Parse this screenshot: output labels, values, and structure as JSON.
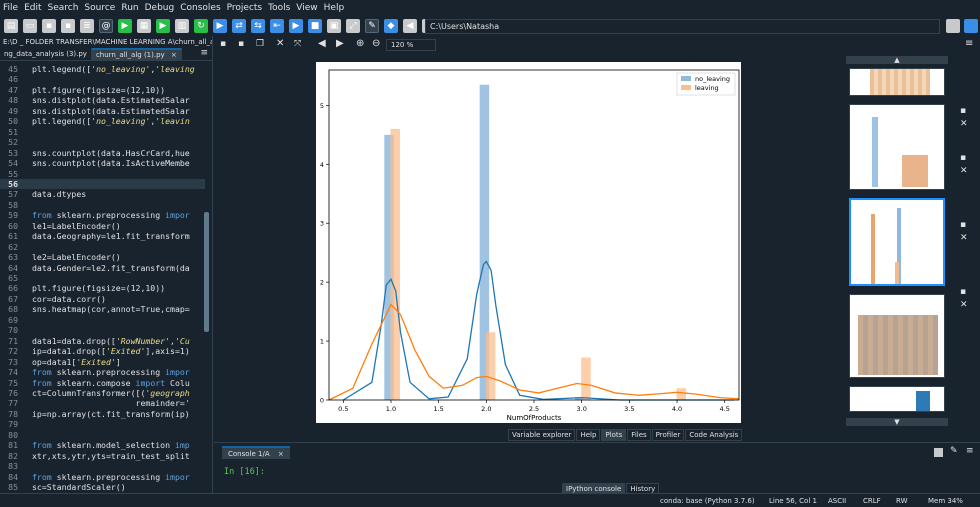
{
  "menu": [
    "File",
    "Edit",
    "Search",
    "Source",
    "Run",
    "Debug",
    "Consoles",
    "Projects",
    "Tools",
    "View",
    "Help"
  ],
  "toolbar": {
    "path": "C:\\Users\\Natasha"
  },
  "editor": {
    "file_path": "E:\\D _ FOLDER TRANSFER\\MACHINE LEARNING A\\churn_all_alg (1).py",
    "tabs": [
      {
        "label": "ng_data_analysis (3).py",
        "active": false
      },
      {
        "label": "churn_all_alg (1).py",
        "active": true
      }
    ],
    "tab_close": "×",
    "lines": [
      {
        "n": "45",
        "t": "plt.legend(['no_leaving','leaving"
      },
      {
        "n": "46",
        "t": ""
      },
      {
        "n": "47",
        "t": "plt.figure(figsize=(12,10))"
      },
      {
        "n": "48",
        "t": "sns.distplot(data.EstimatedSalar"
      },
      {
        "n": "49",
        "t": "sns.distplot(data.EstimatedSalar"
      },
      {
        "n": "50",
        "t": "plt.legend(['no_leaving','leavin"
      },
      {
        "n": "51",
        "t": ""
      },
      {
        "n": "52",
        "t": ""
      },
      {
        "n": "53",
        "t": "sns.countplot(data.HasCrCard,hue"
      },
      {
        "n": "54",
        "t": "sns.countplot(data.IsActiveMembe"
      },
      {
        "n": "55",
        "t": ""
      },
      {
        "n": "56",
        "t": ""
      },
      {
        "n": "57",
        "t": "data.dtypes"
      },
      {
        "n": "58",
        "t": ""
      },
      {
        "n": "59",
        "t": "from sklearn.preprocessing impor"
      },
      {
        "n": "60",
        "t": "le1=LabelEncoder()"
      },
      {
        "n": "61",
        "t": "data.Geography=le1.fit_transform"
      },
      {
        "n": "62",
        "t": ""
      },
      {
        "n": "63",
        "t": "le2=LabelEncoder()"
      },
      {
        "n": "64",
        "t": "data.Gender=le2.fit_transform(da"
      },
      {
        "n": "65",
        "t": ""
      },
      {
        "n": "66",
        "t": "plt.figure(figsize=(12,10))"
      },
      {
        "n": "67",
        "t": "cor=data.corr()"
      },
      {
        "n": "68",
        "t": "sns.heatmap(cor,annot=True,cmap="
      },
      {
        "n": "69",
        "t": ""
      },
      {
        "n": "70",
        "t": ""
      },
      {
        "n": "71",
        "t": "data1=data.drop(['RowNumber','Cu"
      },
      {
        "n": "72",
        "t": "ip=data1.drop(['Exited'],axis=1)"
      },
      {
        "n": "73",
        "t": "op=data1['Exited']"
      },
      {
        "n": "74",
        "t": "from sklearn.preprocessing impor"
      },
      {
        "n": "75",
        "t": "from sklearn.compose import Colu"
      },
      {
        "n": "76",
        "t": "ct=ColumnTransformer([('geograph"
      },
      {
        "n": "77",
        "t": "                     remainder='"
      },
      {
        "n": "78",
        "t": "ip=np.array(ct.fit_transform(ip)"
      },
      {
        "n": "79",
        "t": ""
      },
      {
        "n": "80",
        "t": ""
      },
      {
        "n": "81",
        "t": "from sklearn.model_selection imp"
      },
      {
        "n": "82",
        "t": "xtr,xts,ytr,yts=train_test_split"
      },
      {
        "n": "83",
        "t": ""
      },
      {
        "n": "84",
        "t": "from sklearn.preprocessing impor"
      },
      {
        "n": "85",
        "t": "sc=StandardScaler()"
      }
    ]
  },
  "plots": {
    "zoom": "120 %",
    "pane_tabs": [
      "Variable explorer",
      "Help",
      "Plots",
      "Files",
      "Profiler",
      "Code Analysis"
    ],
    "active_pane_tab": "Plots"
  },
  "console": {
    "tab_label": "Console 1/A",
    "tab_close": "×",
    "prompt": "In [16]:",
    "pane_tabs": [
      "IPython console",
      "History"
    ],
    "active_pane_tab": "IPython console"
  },
  "status": {
    "conda": "conda: base (Python 3.7.6)",
    "position": "Line 56, Col 1",
    "encoding": "ASCII",
    "eol": "CRLF",
    "rw": "RW",
    "mem": "Mem 34%"
  },
  "colors": {
    "no_leaving": "#1f77b4",
    "leaving": "#ff7f0e",
    "accent": "#1464a0"
  },
  "chart_data": {
    "type": "bar",
    "xlabel": "NumOfProducts",
    "ylabel": "",
    "xlim": [
      0.35,
      4.65
    ],
    "ylim": [
      0,
      5.6
    ],
    "xticks": [
      "0.5",
      "1.0",
      "1.5",
      "2.0",
      "2.5",
      "3.0",
      "3.5",
      "4.0",
      "4.5"
    ],
    "yticks": [
      "0",
      "1",
      "2",
      "3",
      "4",
      "5"
    ],
    "legend_position": "top-right",
    "bar_width": 0.1,
    "series": [
      {
        "name": "no_leaving",
        "x": [
          1.0,
          2.0,
          3.0
        ],
        "values": [
          4.5,
          5.35,
          0.05
        ],
        "kde": [
          [
            0.5,
            0
          ],
          [
            0.8,
            0.3
          ],
          [
            0.9,
            1.3
          ],
          [
            0.95,
            1.95
          ],
          [
            1.0,
            2.05
          ],
          [
            1.05,
            1.85
          ],
          [
            1.1,
            1.15
          ],
          [
            1.2,
            0.3
          ],
          [
            1.4,
            0.02
          ],
          [
            1.6,
            0.05
          ],
          [
            1.8,
            0.7
          ],
          [
            1.9,
            1.8
          ],
          [
            1.97,
            2.3
          ],
          [
            2.0,
            2.35
          ],
          [
            2.05,
            2.2
          ],
          [
            2.1,
            1.6
          ],
          [
            2.2,
            0.6
          ],
          [
            2.35,
            0.08
          ],
          [
            2.6,
            0.01
          ],
          [
            3.0,
            0.04
          ],
          [
            3.4,
            0.0
          ],
          [
            4.6,
            0.0
          ]
        ]
      },
      {
        "name": "leaving",
        "x": [
          1.0,
          2.0,
          3.0,
          4.0
        ],
        "values": [
          4.6,
          1.15,
          0.72,
          0.2
        ],
        "kde": [
          [
            0.35,
            0.0
          ],
          [
            0.6,
            0.2
          ],
          [
            0.8,
            0.95
          ],
          [
            1.0,
            1.62
          ],
          [
            1.1,
            1.45
          ],
          [
            1.25,
            0.85
          ],
          [
            1.4,
            0.4
          ],
          [
            1.55,
            0.2
          ],
          [
            1.75,
            0.25
          ],
          [
            1.9,
            0.38
          ],
          [
            2.0,
            0.4
          ],
          [
            2.15,
            0.32
          ],
          [
            2.35,
            0.17
          ],
          [
            2.55,
            0.12
          ],
          [
            2.8,
            0.22
          ],
          [
            2.95,
            0.28
          ],
          [
            3.1,
            0.25
          ],
          [
            3.35,
            0.12
          ],
          [
            3.6,
            0.08
          ],
          [
            3.85,
            0.11
          ],
          [
            4.0,
            0.13
          ],
          [
            4.2,
            0.1
          ],
          [
            4.45,
            0.04
          ],
          [
            4.65,
            0.02
          ]
        ]
      }
    ]
  }
}
